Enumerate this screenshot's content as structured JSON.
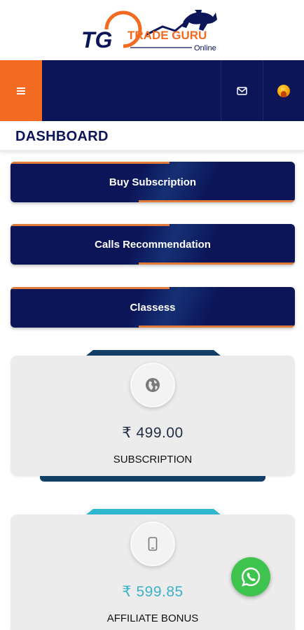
{
  "brand": {
    "monogram": "TG",
    "name": "TRADE GURU",
    "tagline": "Online"
  },
  "navbar": {
    "menu_icon": "hamburger-menu-icon",
    "mail_icon": "mail-icon",
    "avatar_icon": "user-avatar-icon"
  },
  "page": {
    "title": "DASHBOARD"
  },
  "actions": [
    {
      "label": "Buy Subscription"
    },
    {
      "label": "Calls Recommendation"
    },
    {
      "label": "Classess"
    }
  ],
  "stats": [
    {
      "value": "₹ 499.00",
      "label": "SUBSCRIPTION",
      "icon": "globe-icon",
      "value_color": "#1f2d44",
      "accent": "#123f66"
    },
    {
      "value": "₹ 599.85",
      "label": "AFFILIATE BONUS",
      "icon": "mobile-phone-icon",
      "value_color": "#3bb3c9",
      "accent": "#2fb7cf"
    }
  ],
  "floating": {
    "whatsapp_icon": "whatsapp-icon"
  },
  "colors": {
    "navy": "#0b1558",
    "orange": "#f26b21",
    "card_bg": "#ececec"
  }
}
